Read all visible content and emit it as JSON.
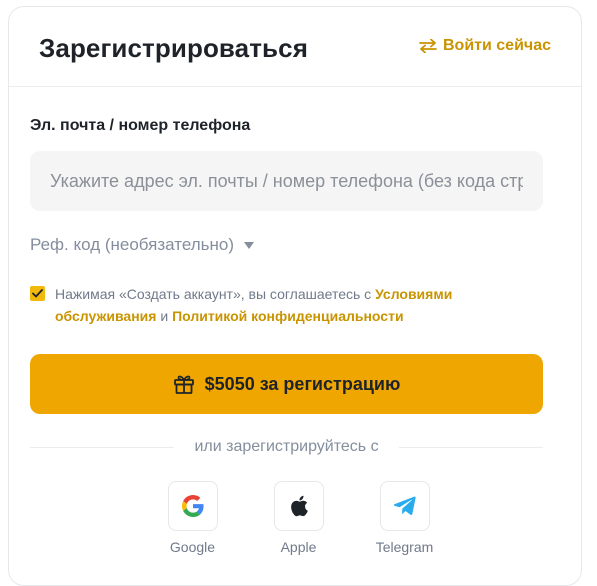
{
  "header": {
    "title": "Зарегистрироваться",
    "login_link": "Войти сейчас"
  },
  "form": {
    "field_label": "Эл. почта / номер телефона",
    "input_placeholder": "Укажите адрес эл. почты / номер телефона (без кода страны)",
    "input_value": "",
    "ref_code_label": "Реф. код (необязательно)",
    "consent": {
      "checked": true,
      "prefix": "Нажимая «Создать аккаунт», вы соглашаетесь с ",
      "terms_link": "Условиями обслуживания",
      "middle": " и ",
      "privacy_link": "Политикой конфиденциальности"
    },
    "submit_label": "$5050 за регистрацию"
  },
  "divider_text": "или зарегистрируйтесь с",
  "socials": [
    {
      "label": "Google",
      "icon": "google-icon"
    },
    {
      "label": "Apple",
      "icon": "apple-icon"
    },
    {
      "label": "Telegram",
      "icon": "telegram-icon"
    }
  ],
  "colors": {
    "accent": "#f0a600",
    "link": "#c99400",
    "telegram": "#2aabee"
  }
}
